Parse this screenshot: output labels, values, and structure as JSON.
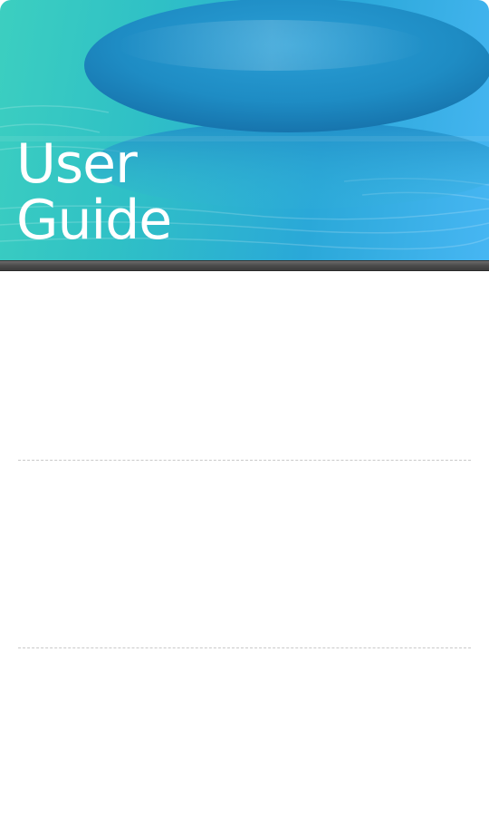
{
  "header": {
    "title_line1": "User",
    "title_line2": "Guide",
    "gradient_colors": [
      "#3ccfc0",
      "#2aa8d8",
      "#47b6f3"
    ],
    "stone_color": "#1e8fc8"
  },
  "header_bar": {
    "color": "#4a4a4a"
  },
  "divider": {
    "color": "#c9c9c9",
    "style": "dashed"
  }
}
